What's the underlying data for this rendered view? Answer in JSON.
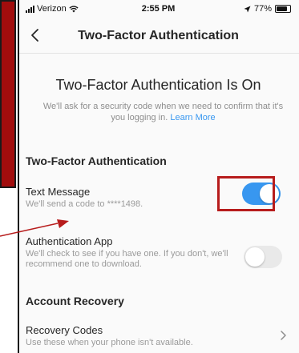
{
  "status_bar": {
    "carrier": "Verizon",
    "time": "2:55 PM",
    "battery": "77%"
  },
  "nav": {
    "title": "Two-Factor Authentication"
  },
  "hero": {
    "title": "Two-Factor Authentication Is On",
    "description": "We'll ask for a security code when we need to confirm that it's you logging in.",
    "link": "Learn More"
  },
  "sections": {
    "two_factor": {
      "title": "Two-Factor Authentication",
      "text_message": {
        "title": "Text Message",
        "desc": "We'll send a code to ****1498.",
        "enabled": true
      },
      "auth_app": {
        "title": "Authentication App",
        "desc": "We'll check to see if you have one. If you don't, we'll recommend one to download.",
        "enabled": false
      }
    },
    "recovery": {
      "title": "Account Recovery",
      "codes": {
        "title": "Recovery Codes",
        "desc": "Use these when your phone isn't available."
      }
    }
  },
  "colors": {
    "accent": "#3897f0",
    "annotation": "#b71c1c",
    "side_panel": "#a10d0d"
  }
}
